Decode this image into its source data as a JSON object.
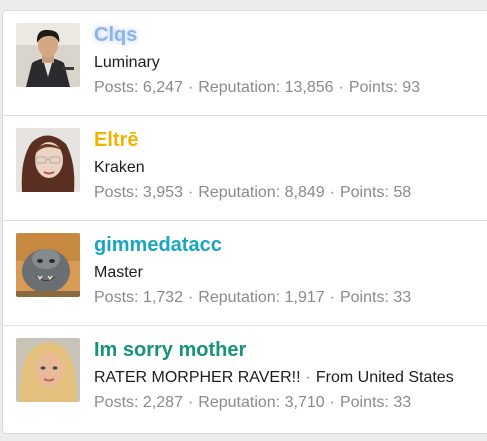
{
  "members": [
    {
      "username": "Clqs",
      "username_color": "#8db4e6",
      "title": "Luminary",
      "location": "",
      "stats": [
        {
          "label": "Posts:",
          "value": "6,247"
        },
        {
          "label": "Reputation:",
          "value": "13,856"
        },
        {
          "label": "Points:",
          "value": "93"
        }
      ]
    },
    {
      "username": "Eltrē",
      "username_color": "#f0b400",
      "title": "Kraken",
      "location": "",
      "stats": [
        {
          "label": "Posts:",
          "value": "3,953"
        },
        {
          "label": "Reputation:",
          "value": "8,849"
        },
        {
          "label": "Points:",
          "value": "58"
        }
      ]
    },
    {
      "username": "gimmedatacc",
      "username_color": "#19a6c2",
      "title": "Master",
      "location": "",
      "stats": [
        {
          "label": "Posts:",
          "value": "1,732"
        },
        {
          "label": "Reputation:",
          "value": "1,917"
        },
        {
          "label": "Points:",
          "value": "33"
        }
      ]
    },
    {
      "username": "Im sorry mother",
      "username_color": "#17937a",
      "title": "RATER MORPHER RAVER!!",
      "location": "From United States",
      "stats": [
        {
          "label": "Posts:",
          "value": "2,287"
        },
        {
          "label": "Reputation:",
          "value": "3,710"
        },
        {
          "label": "Points:",
          "value": "33"
        }
      ]
    }
  ],
  "separator": "·"
}
